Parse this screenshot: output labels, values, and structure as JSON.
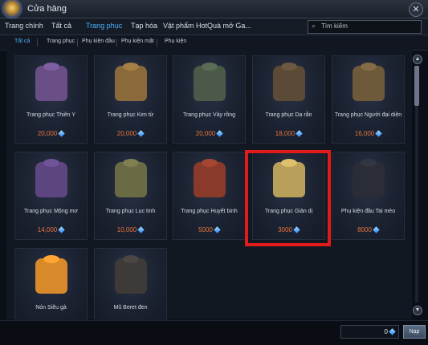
{
  "window": {
    "title": "Cửa hàng"
  },
  "tabs": [
    {
      "label": "Trang chính",
      "active": false
    },
    {
      "label": "Tất cả",
      "active": false
    },
    {
      "label": "Trang phục",
      "active": true
    },
    {
      "label": "Tạp hóa",
      "active": false
    },
    {
      "label": "Vật phẩm Hot",
      "active": false
    },
    {
      "label": "Quà mở Ga...",
      "active": false
    }
  ],
  "search": {
    "placeholder": "Tìm kiếm",
    "icon": "search-icon"
  },
  "subtabs": [
    {
      "label": "Tất cả",
      "active": true
    },
    {
      "label": "Trang phục",
      "active": false
    },
    {
      "label": "Phụ kiện đầu",
      "active": false
    },
    {
      "label": "Phụ kiện mặt",
      "active": false
    },
    {
      "label": "Phụ kiện",
      "active": false
    }
  ],
  "items": [
    {
      "name": "Trang phục Thiên Y",
      "price": "20,000",
      "color": "#6a4f86"
    },
    {
      "name": "Trang phục Kim tử",
      "price": "20,000",
      "color": "#8a6a3a"
    },
    {
      "name": "Trang phục Vảy rồng",
      "price": "20,000",
      "color": "#4b5a48"
    },
    {
      "name": "Trang phục Da rắn",
      "price": "18,000",
      "color": "#5a4a36"
    },
    {
      "name": "Trang phục Người đại diện",
      "price": "16,000",
      "color": "#6e5a3a"
    },
    {
      "name": "Trang phục Mộng mơ",
      "price": "14,000",
      "color": "#5d4680"
    },
    {
      "name": "Trang phục Lục tinh",
      "price": "10,000",
      "color": "#6a6a44"
    },
    {
      "name": "Trang phục Huyết binh",
      "price": "5000",
      "color": "#8a3a2a"
    },
    {
      "name": "Trang phục Giản dị",
      "price": "3000",
      "color": "#b9a05a"
    },
    {
      "name": "Phụ kiện đầu Tai mèo",
      "price": "8000",
      "color": "#2a2d36"
    },
    {
      "name": "Nón Siêu gà",
      "price": "",
      "color": "#d88a2a"
    },
    {
      "name": "Mũ Beret đen",
      "price": "",
      "color": "#3d3a38"
    }
  ],
  "footer": {
    "balance": "0",
    "topup_label": "Nạp"
  },
  "colors": {
    "accent": "#49b3ff",
    "price": "#e8733a",
    "highlight": "#e11b1b"
  }
}
